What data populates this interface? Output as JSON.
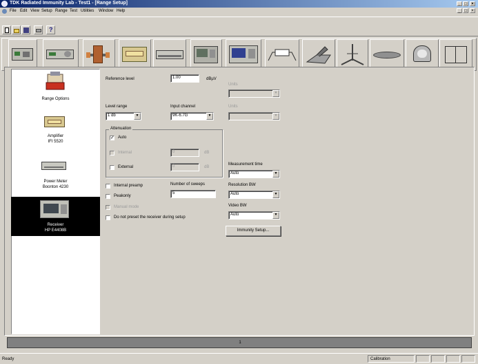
{
  "window": {
    "title": "TDK Radiated Immunity Lab - Test1 - [Range Setup]",
    "controls_top": [
      "_",
      "□",
      "×"
    ],
    "controls_mdi": [
      "_",
      "□",
      "×"
    ]
  },
  "menu": [
    "File",
    "Edit",
    "View",
    "Setup",
    "Range",
    "Test",
    "Utilities",
    "Window",
    "Help"
  ],
  "icons": {
    "toolbar_small": [
      "new-icon",
      "open-icon",
      "save-icon",
      "print-icon",
      "help-icon"
    ],
    "toolbar_large": [
      "signal-generator-icon",
      "amplifier-icon",
      "coupler-icon",
      "power-meter-icon",
      "receiver-icon",
      "monitor-icon",
      "spectrum-icon",
      "cable-icon",
      "lisn-icon",
      "tripod-icon",
      "plate-icon",
      "dome-icon",
      "enclosure-icon"
    ]
  },
  "sidebar": {
    "items": [
      {
        "label": "Range Options",
        "label2": ""
      },
      {
        "label": "Amplifier",
        "label2": "IFI 5520"
      },
      {
        "label": "Power Meter",
        "label2": "Boonton 4230"
      },
      {
        "label": "Receiver",
        "label2": "HP E4408B"
      }
    ]
  },
  "form": {
    "reference_level": {
      "label": "Reference level",
      "value": "1.00",
      "unit": "dBµV"
    },
    "units1": {
      "label": "Units",
      "value": ""
    },
    "level_range": {
      "label": "Level range",
      "value": "1 db"
    },
    "input_channel": {
      "label": "Input channel",
      "value": "9K-6.7G"
    },
    "units2": {
      "label": "Units",
      "value": ""
    },
    "attenuation": {
      "title": "Attenuation",
      "auto": "Auto",
      "internal": "Internal",
      "internal_value": "0",
      "internal_unit": "dB",
      "external": "External",
      "external_value": "0",
      "external_unit": "dB"
    },
    "measurement_time": {
      "label": "Measurement time",
      "value": "Auto"
    },
    "internal_preamp": "Internal preamp",
    "number_of_sweeps": {
      "label": "Number of sweeps",
      "value": "5"
    },
    "peakonly": "Peakonly",
    "manual_mode": "Manual mode",
    "do_not_preset": "Do not preset the receiver during setup",
    "resolution_bw": {
      "label": "Resolution BW",
      "value": "Auto"
    },
    "video_bw": {
      "label": "Video BW",
      "value": "Auto"
    },
    "immunity_setup_button": "Immunity Setup..."
  },
  "bottom_bar": {
    "text": "1"
  },
  "status": {
    "left": "Ready",
    "right": "Calibration"
  }
}
